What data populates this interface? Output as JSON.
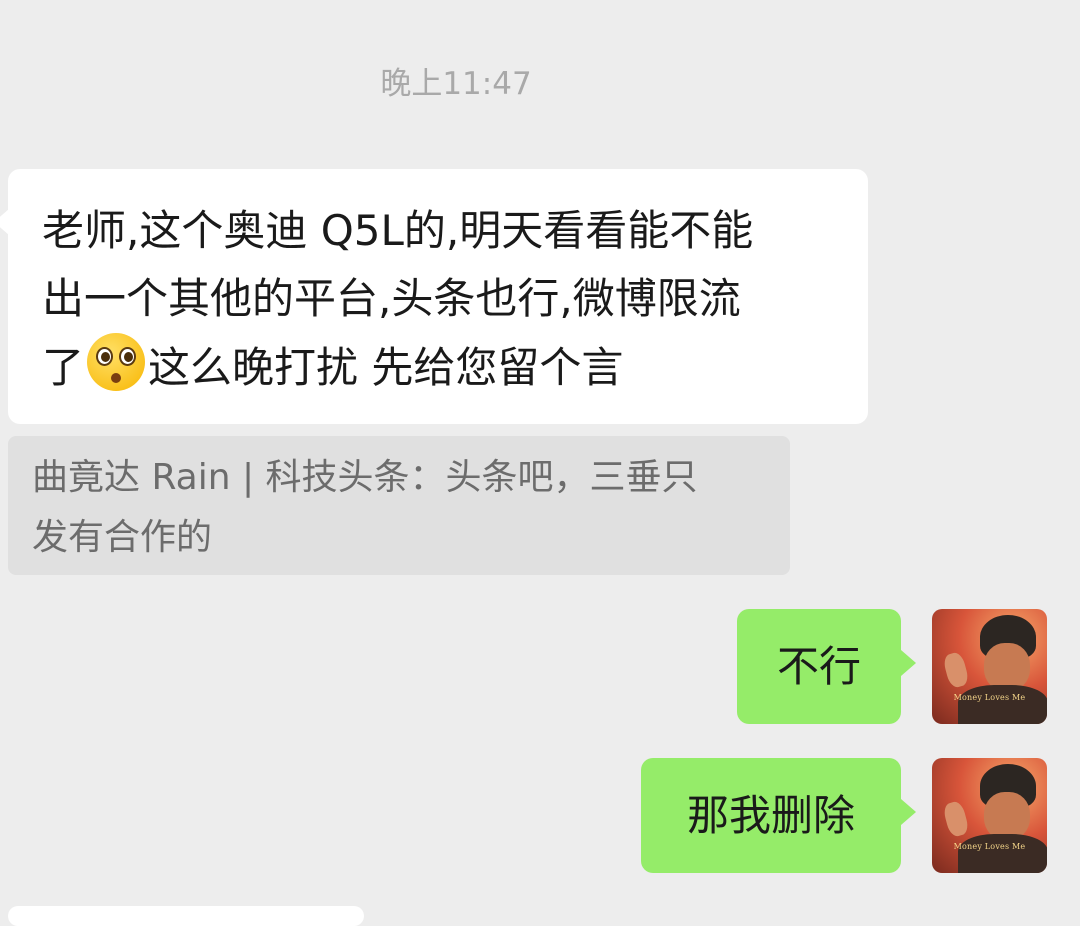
{
  "chat": {
    "timestamp": "晚上11:47",
    "messages": [
      {
        "direction": "incoming",
        "text_line1": "老师,这个奥迪 Q5L的,明天看看能不能",
        "text_line2": "出一个其他的平台,头条也行,微博限流",
        "text_line3_before_emoji": "了",
        "emoji": "pleading-face-emoji",
        "text_line3_after_emoji": "这么晚打扰 先给您留个言"
      },
      {
        "direction": "quote",
        "text_line1": "曲竟达 Rain | 科技头条：头条吧，三垂只",
        "text_line2": "发有合作的"
      },
      {
        "direction": "outgoing",
        "text": "不行"
      },
      {
        "direction": "outgoing",
        "text": "那我删除"
      }
    ],
    "avatar_caption": "Money Loves Me"
  },
  "colors": {
    "background": "#ededed",
    "incoming_bubble": "#ffffff",
    "outgoing_bubble": "#95ec69",
    "quote_bubble": "#e0e0e0",
    "timestamp_text": "#a9a9a9"
  }
}
